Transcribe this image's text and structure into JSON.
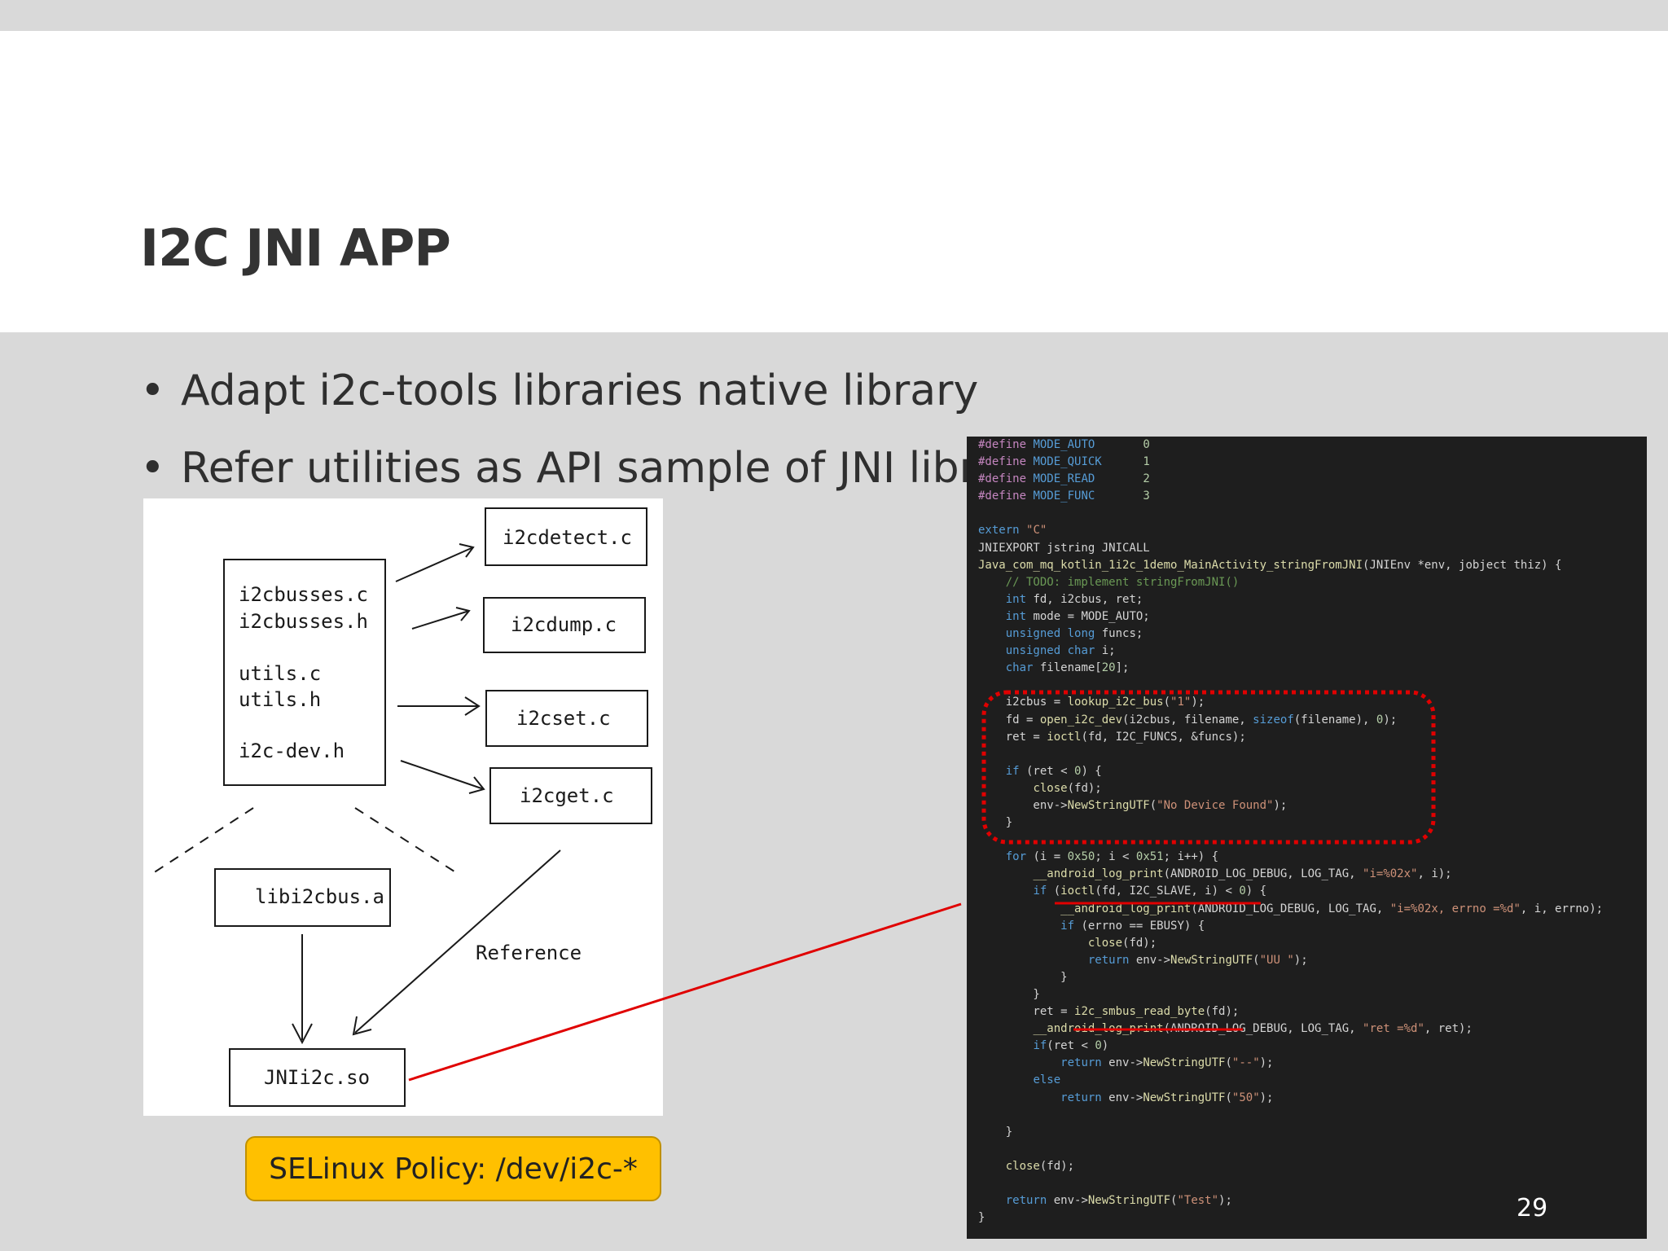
{
  "slide": {
    "title": "I2C JNI APP",
    "bullets": [
      "Adapt i2c-tools libraries native library",
      "Refer utilities as API sample of JNI library"
    ],
    "page_number": "29"
  },
  "diagram": {
    "left_box": [
      "i2cbusses.c",
      "i2cbusses.h",
      "utils.c",
      "utils.h",
      "i2c-dev.h"
    ],
    "right_boxes": [
      "i2cdetect.c",
      "i2cdump.c",
      "i2cset.c",
      "i2cget.c"
    ],
    "lib_box": "libi2cbus.a",
    "so_box": "JNIi2c.so",
    "reference_label": "Reference"
  },
  "selinux_label": "SELinux Policy: /dev/i2c-*",
  "code_lines": [
    "#define MODE_AUTO       0",
    "#define MODE_QUICK      1",
    "#define MODE_READ       2",
    "#define MODE_FUNC       3",
    "",
    "extern \"C\"",
    "JNIEXPORT jstring JNICALL",
    "Java_com_mq_kotlin_1i2c_1demo_MainActivity_stringFromJNI(JNIEnv *env, jobject thiz) {",
    "    // TODO: implement stringFromJNI()",
    "    int fd, i2cbus, ret;",
    "    int mode = MODE_AUTO;",
    "    unsigned long funcs;",
    "    unsigned char i;",
    "    char filename[20];",
    "",
    "    i2cbus = lookup_i2c_bus(\"1\");",
    "    fd = open_i2c_dev(i2cbus, filename, sizeof(filename), 0);",
    "    ret = ioctl(fd, I2C_FUNCS, &funcs);",
    "",
    "    if (ret < 0) {",
    "        close(fd);",
    "        env->NewStringUTF(\"No Device Found\");",
    "    }",
    "",
    "    for (i = 0x50; i < 0x51; i++) {",
    "        __android_log_print(ANDROID_LOG_DEBUG, LOG_TAG, \"i=%02x\", i);",
    "        if (ioctl(fd, I2C_SLAVE, i) < 0) {",
    "            __android_log_print(ANDROID_LOG_DEBUG, LOG_TAG, \"i=%02x, errno =%d\", i, errno);",
    "            if (errno == EBUSY) {",
    "                close(fd);",
    "                return env->NewStringUTF(\"UU \");",
    "            }",
    "        }",
    "        ret = i2c_smbus_read_byte(fd);",
    "        __android_log_print(ANDROID_LOG_DEBUG, LOG_TAG, \"ret =%d\", ret);",
    "        if(ret < 0)",
    "            return env->NewStringUTF(\"--\");",
    "        else",
    "            return env->NewStringUTF(\"50\");",
    "",
    "    }",
    "",
    "    close(fd);",
    "",
    "    return env->NewStringUTF(\"Test\");",
    "}"
  ]
}
